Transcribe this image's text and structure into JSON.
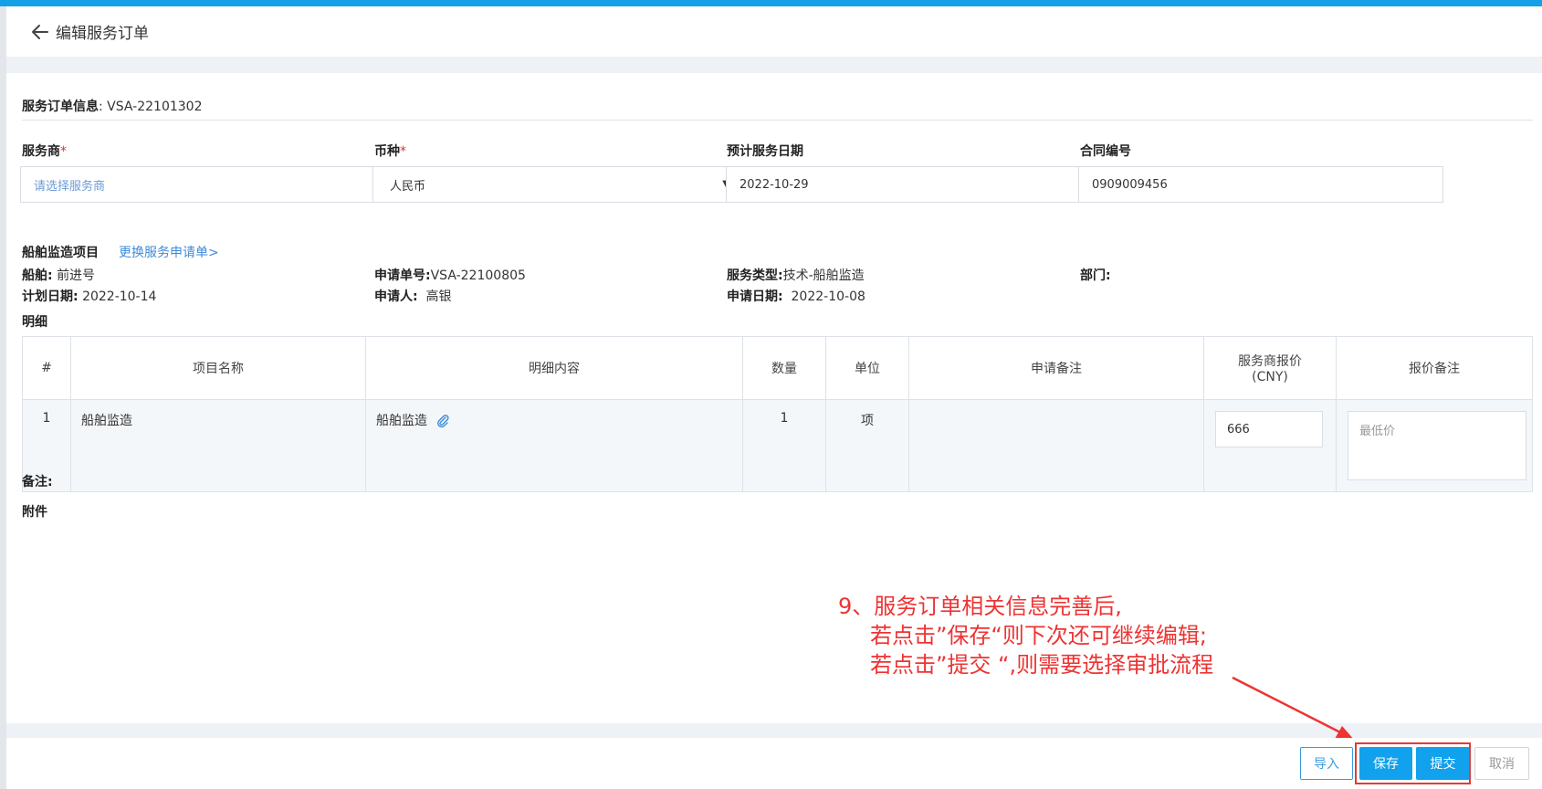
{
  "header": {
    "title": "编辑服务订单"
  },
  "order_info": {
    "label": "服务订单信息",
    "separator": ":",
    "order_no": "VSA-22101302"
  },
  "fields": {
    "provider": {
      "label": "服务商",
      "required_mark": "*",
      "placeholder": "请选择服务商"
    },
    "currency": {
      "label": "币种",
      "required_mark": "*",
      "value": "人民币"
    },
    "service_date": {
      "label": "预计服务日期",
      "value": "2022-10-29"
    },
    "contract_no": {
      "label": "合同编号",
      "value": "0909009456"
    }
  },
  "ship_section": {
    "title": "船舶监造项目",
    "change_link": "更换服务申请单>",
    "ship": {
      "label": "船舶:",
      "value": "前进号"
    },
    "plan_date": {
      "label": "计划日期:",
      "value": "2022-10-14"
    },
    "apply_no": {
      "label": "申请单号:",
      "value": "VSA-22100805"
    },
    "applicant": {
      "label": "申请人:",
      "value": "高银"
    },
    "service_type": {
      "label": "服务类型:",
      "value": "技术-船舶监造"
    },
    "apply_date": {
      "label": "申请日期:",
      "value": "2022-10-08"
    },
    "department": {
      "label": "部门:",
      "value": ""
    }
  },
  "detail": {
    "title": "明细",
    "columns": [
      "#",
      "项目名称",
      "明细内容",
      "数量",
      "单位",
      "申请备注",
      "服务商报价",
      "(CNY)",
      "报价备注"
    ],
    "rows": [
      {
        "index": "1",
        "name": "船舶监造",
        "content": "船舶监造",
        "qty": "1",
        "unit": "项",
        "apply_note": "",
        "price": "666",
        "price_note_placeholder": "最低价"
      }
    ]
  },
  "remark_label": "备注:",
  "attachment_label": "附件",
  "annotation": {
    "line1": "9、服务订单相关信息完善后,",
    "line2": "若点击”保存“则下次还可继续编辑;",
    "line3": "若点击”提交 “,则需要选择审批流程"
  },
  "buttons": {
    "import": "导入",
    "save": "保存",
    "submit": "提交",
    "cancel": "取消"
  },
  "colors": {
    "accent": "#12a1ec",
    "annotation": "#ee3333",
    "link": "#3d8bd9"
  }
}
